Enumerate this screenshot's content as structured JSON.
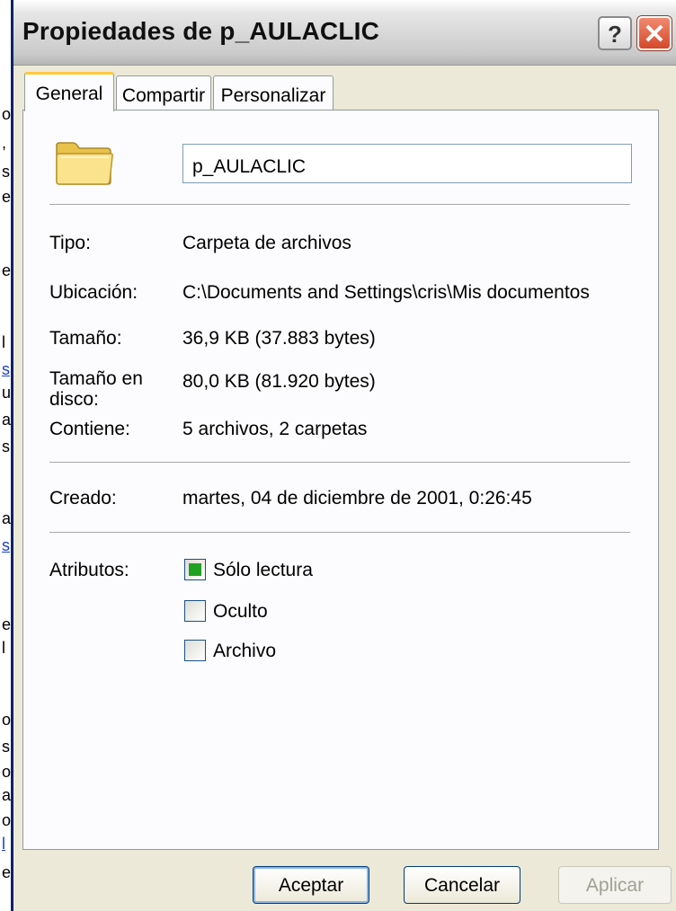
{
  "background_page": {
    "fragments": [
      "o",
      ",",
      "s",
      "e",
      "e",
      "l",
      "s",
      "u",
      "a",
      "s",
      "a",
      "s",
      "e",
      "l",
      "o",
      "s",
      "o",
      "a",
      "o",
      "l",
      "e"
    ]
  },
  "window": {
    "title": "Propiedades de p_AULACLIC",
    "help_glyph": "?",
    "close_glyph": "✕"
  },
  "tabs": [
    {
      "label": "General",
      "active": true
    },
    {
      "label": "Compartir",
      "active": false
    },
    {
      "label": "Personalizar",
      "active": false
    }
  ],
  "general": {
    "folder_icon": "folder-icon",
    "name_value": "p_AULACLIC",
    "fields": [
      {
        "label": "Tipo:",
        "value": "Carpeta de archivos"
      },
      {
        "label": "Ubicación:",
        "value": "C:\\Documents and Settings\\cris\\Mis documentos"
      },
      {
        "label": "Tamaño:",
        "value": "36,9 KB (37.883 bytes)"
      },
      {
        "label": "Tamaño en disco:",
        "value": "80,0 KB (81.920 bytes)"
      },
      {
        "label": "Contiene:",
        "value": "5 archivos, 2 carpetas"
      }
    ],
    "created": {
      "label": "Creado:",
      "value": "martes, 04 de diciembre de 2001, 0:26:45"
    },
    "attributes": {
      "label": "Atributos:",
      "items": [
        {
          "label": "Sólo lectura",
          "checked": true
        },
        {
          "label": "Oculto",
          "checked": false
        },
        {
          "label": "Archivo",
          "checked": false
        }
      ]
    }
  },
  "buttons": {
    "ok": "Aceptar",
    "cancel": "Cancelar",
    "apply": "Aplicar"
  },
  "colors": {
    "dialog_bg": "#ece9d8",
    "active_tab_accent": "#ffc83c",
    "close_button": "#d6482a",
    "checkbox_fill": "#21a121"
  }
}
